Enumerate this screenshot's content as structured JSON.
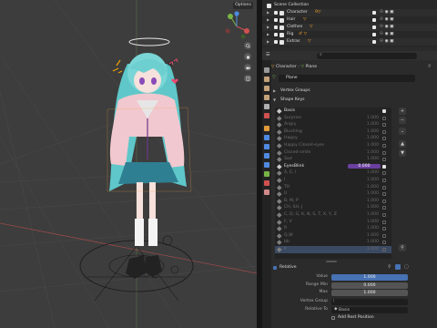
{
  "viewport": {
    "options_label": "Options"
  },
  "outliner": {
    "scene_label": "Scene Collection",
    "items": [
      {
        "label": "Character",
        "aux": "9▽"
      },
      {
        "label": "Hair",
        "aux": "▽"
      },
      {
        "label": "Clothes",
        "aux": "▽"
      },
      {
        "label": "Rig",
        "aux": "♂ ▽"
      },
      {
        "label": "Extras",
        "aux": "▽"
      }
    ]
  },
  "properties": {
    "search_placeholder": "",
    "breadcrumb": {
      "object": "Character",
      "mesh": "Plane"
    },
    "mesh_name": "Plane",
    "vertex_groups_label": "Vertex Groups",
    "shape_keys_label": "Shape Keys",
    "shape_keys": [
      {
        "name": "Basis",
        "value": "",
        "active": true
      },
      {
        "name": "Surprise",
        "value": "1.000",
        "active": false
      },
      {
        "name": "Angry",
        "value": "1.000",
        "active": false
      },
      {
        "name": "Blushing",
        "value": "1.000",
        "active": false
      },
      {
        "name": "Happy",
        "value": "1.000",
        "active": false
      },
      {
        "name": "Happy Closed-eyes",
        "value": "1.000",
        "active": false
      },
      {
        "name": "Closed-smile",
        "value": "1.000",
        "active": false
      },
      {
        "name": "Sad",
        "value": "1.000",
        "active": false
      },
      {
        "name": "EyesBlink",
        "value": "0.000",
        "active": true,
        "selected_value": true
      },
      {
        "name": "A, E, I",
        "value": "1.000",
        "active": false
      },
      {
        "name": "I",
        "value": "1.000",
        "active": false
      },
      {
        "name": "TH",
        "value": "1.000",
        "active": false
      },
      {
        "name": "U",
        "value": "1.000",
        "active": false
      },
      {
        "name": "B, M, P",
        "value": "1.000",
        "active": false
      },
      {
        "name": "CH, SH, J",
        "value": "1.000",
        "active": false
      },
      {
        "name": "C, D, G, K, N, S, T, X, Y, Z",
        "value": "1.000",
        "active": false
      },
      {
        "name": "F, V",
        "value": "1.000",
        "active": false
      },
      {
        "name": "R",
        "value": "1.000",
        "active": false
      },
      {
        "name": "Q,W",
        "value": "1.000",
        "active": false
      },
      {
        "name": "bb",
        "value": "1.000",
        "active": false
      },
      {
        "name": "ll",
        "value": "1.000",
        "active": false,
        "highlighted": true
      }
    ],
    "relative_label": "Relative",
    "value_label": "Value",
    "value": "1.000",
    "range_min_label": "Range Min",
    "range_min": "0.000",
    "max_label": "Max",
    "max": "1.000",
    "vertex_group_label": "Vertex Group",
    "vertex_group_value": "",
    "relative_to_label": "Relative To",
    "relative_to_value": "Basis",
    "add_rest_label": "Add Rest Position"
  }
}
